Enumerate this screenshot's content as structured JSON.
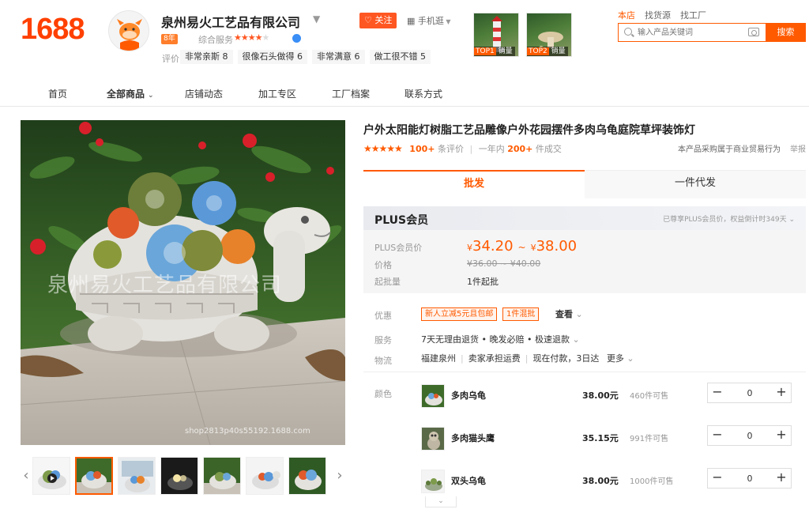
{
  "brand": {
    "logo": "1688",
    "color": "#ff5a00"
  },
  "shop": {
    "name": "泉州易火工艺品有限公司",
    "follow_label": "关注",
    "mobile_label": "手机逛",
    "years_badge": "8年",
    "rating_label": "综合服务",
    "rating_stars": 4.5,
    "review_label": "评价",
    "tags": [
      "非常亲斯 8",
      "很像石头做得 6",
      "非常满意 6",
      "做工很不错 5"
    ]
  },
  "top_products": [
    {
      "rank": "TOP1",
      "label": "销量"
    },
    {
      "rank": "TOP2",
      "label": "销量"
    }
  ],
  "search": {
    "tabs": [
      "本店",
      "找货源",
      "找工厂"
    ],
    "placeholder": "输入产品关键词",
    "button": "搜索"
  },
  "nav": [
    "首页",
    "全部商品",
    "店铺动态",
    "加工专区",
    "工厂档案",
    "联系方式"
  ],
  "gallery": {
    "watermark": "泉州易火工艺品有限公司",
    "url": "shop2813p40s55192.1688.com",
    "thumb_count": 7,
    "selected": 1
  },
  "product": {
    "title": "户外太阳能灯树脂工艺品雕像户外花园摆件多肉乌龟庭院草坪装饰灯",
    "rating": 5,
    "review_count": "100+",
    "review_suffix": "条评价",
    "sales_prefix": "一年内",
    "sales_count": "200+",
    "sales_suffix": "件成交",
    "trade_note": "本产品采购属于商业贸易行为",
    "report": "举报"
  },
  "tabs": {
    "wholesale": "批发",
    "dropship": "一件代发"
  },
  "pricing": {
    "plus_title": "PLUS会员",
    "plus_note": "已尊享PLUS会员价，权益倒计时349天",
    "plus_price_label": "PLUS会员价",
    "currency": "¥",
    "plus_price_low": "34.20",
    "plus_price_high": "38.00",
    "price_label": "价格",
    "original_price": "¥36.00 ~ ¥40.00",
    "moq_label": "起批量",
    "moq": "1件起批"
  },
  "offers": {
    "label": "优惠",
    "coupons": [
      "新人立减5元且包邮",
      "1件混批"
    ],
    "view": "查看"
  },
  "service": {
    "label": "服务",
    "text": "7天无理由退货 • 晚发必赔 • 极速退款"
  },
  "logistics": {
    "label": "物流",
    "origin": "福建泉州",
    "freight": "卖家承担运费",
    "delivery": "现在付款，3日达",
    "more": "更多"
  },
  "variants": {
    "label": "颜色",
    "items": [
      {
        "name": "多肉乌龟",
        "price": "38.00元",
        "stock": "460件可售",
        "qty": "0"
      },
      {
        "name": "多肉猫头鹰",
        "price": "35.15元",
        "stock": "991件可售",
        "qty": "0"
      },
      {
        "name": "双头乌龟",
        "price": "38.00元",
        "stock": "1000件可售",
        "qty": "0"
      }
    ]
  }
}
